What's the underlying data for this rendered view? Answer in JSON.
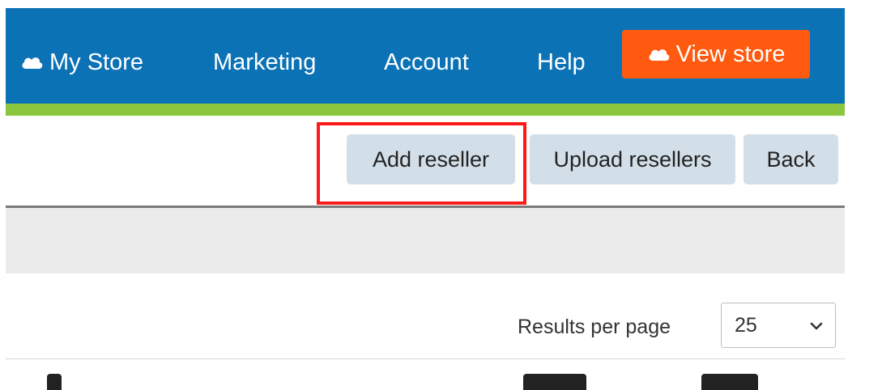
{
  "nav": {
    "my_store": "My Store",
    "marketing": "Marketing",
    "account": "Account",
    "help": "Help",
    "view_store": "View store"
  },
  "toolbar": {
    "add_reseller": "Add reseller",
    "upload_resellers": "Upload resellers",
    "back": "Back"
  },
  "results": {
    "label": "Results per page",
    "selected": "25"
  },
  "colors": {
    "nav_bg": "#0b72b5",
    "accent_green": "#8cc63f",
    "view_store_bg": "#ff5a0f",
    "button_bg": "#d3dfe8",
    "highlight": "#ff1a1a"
  },
  "icons": {
    "cloud": "cloud-icon",
    "dropdown": "chevron-down-icon"
  }
}
